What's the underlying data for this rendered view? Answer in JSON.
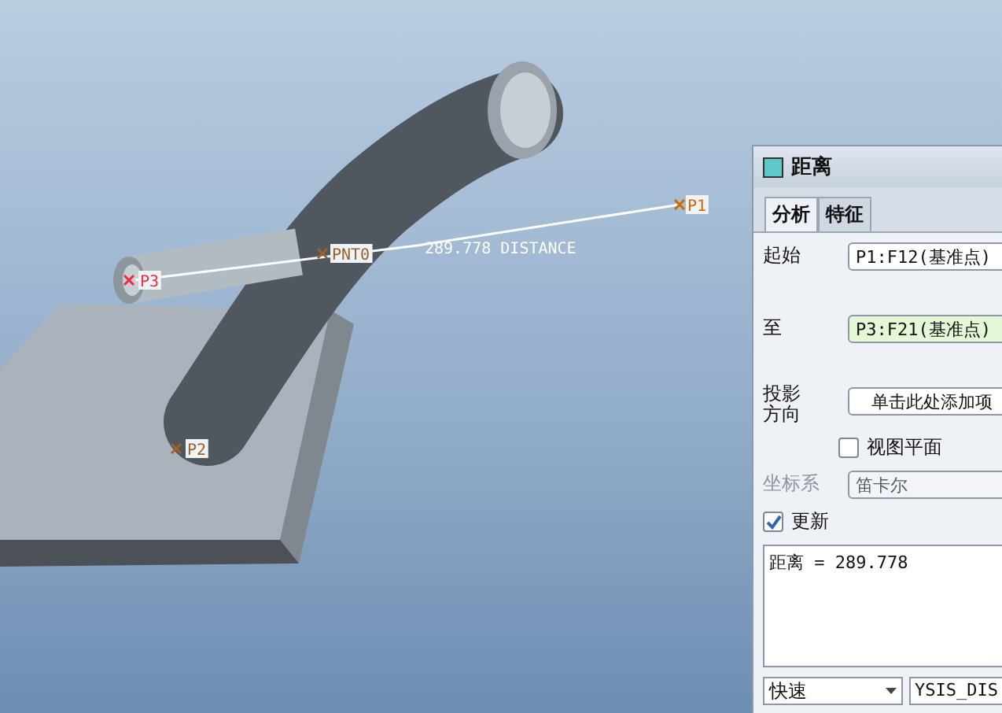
{
  "viewport": {
    "point_labels": [
      {
        "text": "P1",
        "color": "#d06a00"
      },
      {
        "text": "PNT0",
        "color": "#a0602a"
      },
      {
        "text": "P3",
        "color": "#e83040"
      },
      {
        "text": "P2",
        "color": "#a0602a"
      }
    ],
    "dimension": "289.778  DISTANCE"
  },
  "dialog": {
    "title": "距离",
    "tabs": [
      {
        "label": "分析",
        "selected": true
      },
      {
        "label": "特征",
        "selected": false
      }
    ],
    "references": [
      {
        "label": "起始",
        "value": "P1:F12(基准点)",
        "active": false
      },
      {
        "label": "至",
        "value": "P3:F21(基准点)",
        "active": true
      }
    ],
    "projection": {
      "label": "投影方向",
      "button": "单击此处添加项"
    },
    "view_plane": {
      "label": "视图平面",
      "checked": false
    },
    "coordinate_system": {
      "label": "坐标系",
      "value": "笛卡尔",
      "disabled": true
    },
    "update": {
      "label": "更新",
      "checked": true
    },
    "result": "距离 = 289.778",
    "mode_dropdown": {
      "value": "快速"
    },
    "name_field": {
      "value": "YSIS_DIS"
    }
  }
}
